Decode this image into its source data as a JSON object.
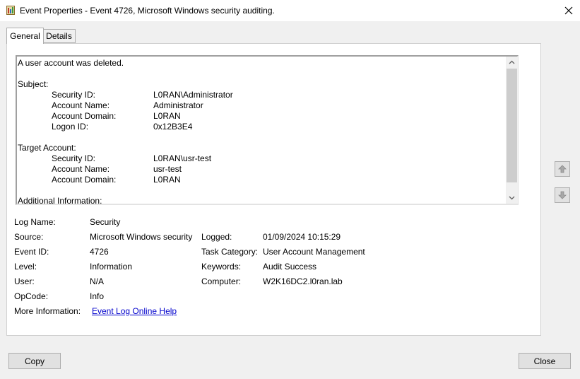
{
  "window": {
    "title": "Event Properties - Event 4726, Microsoft Windows security auditing.",
    "icon": "event-viewer-icon",
    "close_icon": "close-icon"
  },
  "tabs": [
    {
      "label": "General",
      "selected": true
    },
    {
      "label": "Details",
      "selected": false
    }
  ],
  "description": {
    "heading": "A user account was deleted.",
    "subject_header": "Subject:",
    "subject": [
      {
        "label": "Security ID:",
        "value": "L0RAN\\Administrator"
      },
      {
        "label": "Account Name:",
        "value": "Administrator"
      },
      {
        "label": "Account Domain:",
        "value": "L0RAN"
      },
      {
        "label": "Logon ID:",
        "value": "0x12B3E4"
      }
    ],
    "target_header": "Target Account:",
    "target": [
      {
        "label": "Security ID:",
        "value": "L0RAN\\usr-test"
      },
      {
        "label": "Account Name:",
        "value": "usr-test"
      },
      {
        "label": "Account Domain:",
        "value": "L0RAN"
      }
    ],
    "additional_header": "Additional Information:"
  },
  "properties": {
    "log_name_label": "Log Name:",
    "log_name": "Security",
    "source_label": "Source:",
    "source": "Microsoft Windows security",
    "logged_label": "Logged:",
    "logged": "01/09/2024 10:15:29",
    "event_id_label": "Event ID:",
    "event_id": "4726",
    "task_category_label": "Task Category:",
    "task_category": "User Account Management",
    "level_label": "Level:",
    "level": "Information",
    "keywords_label": "Keywords:",
    "keywords": "Audit Success",
    "user_label": "User:",
    "user": "N/A",
    "computer_label": "Computer:",
    "computer": "W2K16DC2.l0ran.lab",
    "opcode_label": "OpCode:",
    "opcode": "Info",
    "more_info_label": "More Information:",
    "more_info_link": "Event Log Online Help"
  },
  "buttons": {
    "copy": "Copy",
    "close": "Close"
  },
  "colors": {
    "link": "#0000cc",
    "window_bg": "#f0f0f0",
    "button_bg": "#e1e1e1"
  }
}
